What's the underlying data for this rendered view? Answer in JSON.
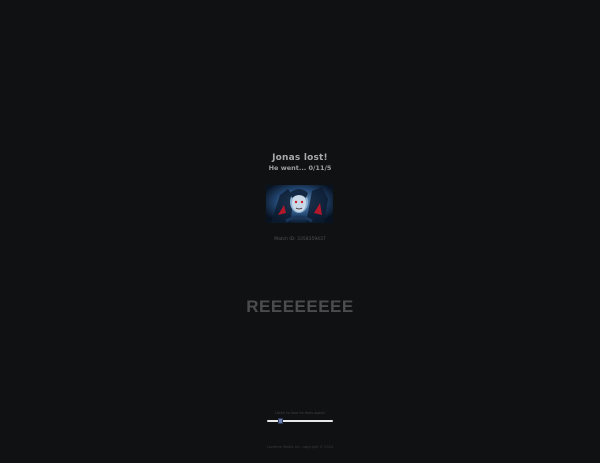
{
  "header": {
    "title": "Jonas lost!",
    "subtitle": "He went... 0/11/5"
  },
  "hero_image": {
    "description": "hero-portrait"
  },
  "match": {
    "label": "Match ID: 3358359437"
  },
  "main": {
    "big_text": "REEEEEEEE"
  },
  "audio": {
    "label": "Listen to how he feels again!",
    "progress": 0.18
  },
  "footer": {
    "text": "Lazorme Media Inc. copyright © 2024"
  },
  "colors": {
    "background": "#0f1112",
    "title": "#a9a9a9",
    "big_text": "#4a4c4e",
    "slider_track": "#e8e8e8",
    "slider_thumb": "#6f7fa8"
  }
}
